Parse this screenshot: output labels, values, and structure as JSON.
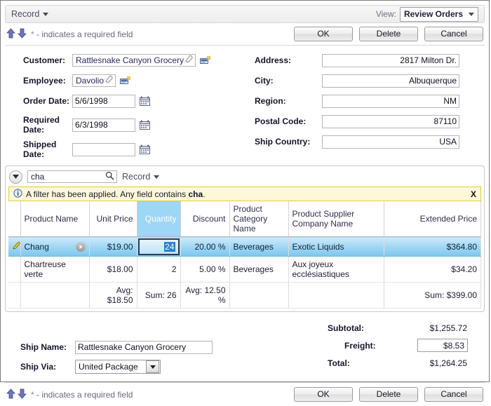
{
  "toolbar": {
    "record_menu": "Record",
    "view_label": "View:",
    "view_value": "Review Orders"
  },
  "action_bar": {
    "required_note_star": "*",
    "required_note_text": " - indicates a required field",
    "ok": "OK",
    "delete": "Delete",
    "cancel": "Cancel"
  },
  "form": {
    "left": [
      {
        "label": "Customer:",
        "value": "Rattlesnake Canyon Grocery"
      },
      {
        "label": "Employee:",
        "value": "Davolio"
      },
      {
        "label": "Order Date:",
        "value": "5/6/1998"
      },
      {
        "label": "Required Date:",
        "value": "6/3/1998"
      },
      {
        "label": "Shipped Date:",
        "value": ""
      }
    ],
    "right": [
      {
        "label": "Address:",
        "value": "2817 Milton Dr."
      },
      {
        "label": "City:",
        "value": "Albuquerque"
      },
      {
        "label": "Region:",
        "value": "NM"
      },
      {
        "label": "Postal Code:",
        "value": "87110"
      },
      {
        "label": "Ship Country:",
        "value": "USA"
      }
    ]
  },
  "grid": {
    "search_value": "cha",
    "record_menu": "Record",
    "filter_prefix": "A filter has been applied. Any field contains ",
    "filter_term": "cha",
    "filter_suffix": ".",
    "filter_close": "X",
    "columns": [
      {
        "label": "Product Name",
        "align": "left"
      },
      {
        "label": "Unit Price",
        "align": "right"
      },
      {
        "label": "Quantity",
        "align": "right",
        "selected": true
      },
      {
        "label": "Discount",
        "align": "right"
      },
      {
        "label": "Product Category Name",
        "align": "left"
      },
      {
        "label": "Product Supplier Company Name",
        "align": "left"
      },
      {
        "label": "Extended Price",
        "align": "right"
      }
    ],
    "rows": [
      {
        "product_name": "Chang",
        "unit_price": "$19.00",
        "quantity": "24",
        "discount": "20.00 %",
        "category": "Beverages",
        "supplier": "Exotic Liquids",
        "extended_price": "$364.80"
      },
      {
        "product_name": "Chartreuse verte",
        "unit_price": "$18.00",
        "quantity": "2",
        "discount": "5.00 %",
        "category": "Beverages",
        "supplier": "Aux joyeux ecclésiastiques",
        "extended_price": "$34.20"
      }
    ],
    "aggregates": {
      "unit_price": "Avg: $18.50",
      "quantity": "Sum: 26",
      "discount": "Avg: 12.50 %",
      "extended_price": "Sum: $399.00"
    }
  },
  "footer": {
    "ship_name_label": "Ship Name:",
    "ship_name_value": "Rattlesnake Canyon Grocery",
    "ship_via_label": "Ship Via:",
    "ship_via_value": "United Package",
    "subtotal_label": "Subtotal:",
    "subtotal_value": "$1,255.72",
    "freight_label": "Freight:",
    "freight_value": "$8.53",
    "total_label": "Total:",
    "total_value": "$1,264.25"
  },
  "colors": {
    "selection_blue": "#a5d9f4",
    "header_selected": "#9ed6f5",
    "filter_yellow": "#fdf8d8",
    "link_blue": "#2f6fba"
  }
}
